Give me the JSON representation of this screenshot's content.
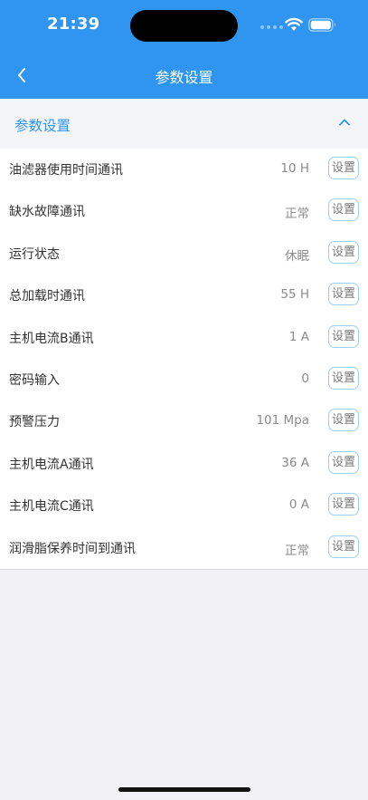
{
  "status_bar": {
    "time": "21:39"
  },
  "nav": {
    "title": "参数设置",
    "back_icon": "chevron-left-icon"
  },
  "section": {
    "title": "参数设置",
    "collapse_icon": "chevron-up-icon"
  },
  "colors": {
    "primary": "#2f95f0",
    "button_border": "#9ad0f4"
  },
  "rows": [
    {
      "label": "油滤器使用时间通讯",
      "value": "10 H",
      "button": "设置"
    },
    {
      "label": "缺水故障通讯",
      "value": "正常",
      "button": "设置"
    },
    {
      "label": "运行状态",
      "value": "休眠",
      "button": "设置"
    },
    {
      "label": "总加载时通讯",
      "value": "55 H",
      "button": "设置"
    },
    {
      "label": "主机电流B通讯",
      "value": "1 A",
      "button": "设置"
    },
    {
      "label": "密码输入",
      "value": "0",
      "button": "设置"
    },
    {
      "label": "预警压力",
      "value": "101 Mpa",
      "button": "设置"
    },
    {
      "label": "主机电流A通讯",
      "value": "36 A",
      "button": "设置"
    },
    {
      "label": "主机电流C通讯",
      "value": "0 A",
      "button": "设置"
    },
    {
      "label": "润滑脂保养时间到通讯",
      "value": "正常",
      "button": "设置"
    }
  ]
}
